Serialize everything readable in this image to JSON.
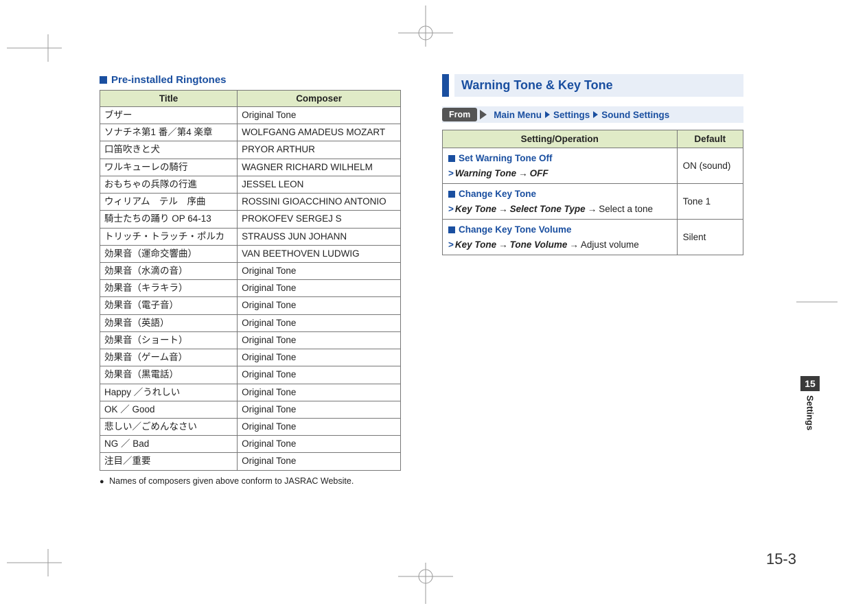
{
  "left": {
    "heading": "Pre-installed Ringtones",
    "table_headers": {
      "title": "Title",
      "composer": "Composer"
    },
    "rows": [
      {
        "title": "ブザー",
        "composer": "Original Tone"
      },
      {
        "title": "ソナチネ第1 番／第4 楽章",
        "composer": "WOLFGANG AMADEUS MOZART"
      },
      {
        "title": "口笛吹きと犬",
        "composer": "PRYOR ARTHUR"
      },
      {
        "title": "ワルキューレの騎行",
        "composer": "WAGNER RICHARD WILHELM"
      },
      {
        "title": "おもちゃの兵隊の行進",
        "composer": "JESSEL LEON"
      },
      {
        "title": "ウィリアム　テル　序曲",
        "composer": "ROSSINI GIOACCHINO ANTONIO"
      },
      {
        "title": "騎士たちの踊り OP 64-13",
        "composer": "PROKOFEV SERGEJ S"
      },
      {
        "title": "トリッチ・トラッチ・ポルカ",
        "composer": "STRAUSS JUN JOHANN"
      },
      {
        "title": "効果音（運命交響曲）",
        "composer": "VAN BEETHOVEN LUDWIG"
      },
      {
        "title": "効果音（水滴の音）",
        "composer": "Original Tone"
      },
      {
        "title": "効果音（キラキラ）",
        "composer": "Original Tone"
      },
      {
        "title": "効果音（電子音）",
        "composer": "Original Tone"
      },
      {
        "title": "効果音（英語）",
        "composer": "Original Tone"
      },
      {
        "title": "効果音（ショート）",
        "composer": "Original Tone"
      },
      {
        "title": "効果音（ゲーム音）",
        "composer": "Original Tone"
      },
      {
        "title": "効果音（黒電話）",
        "composer": "Original Tone"
      },
      {
        "title": "Happy ／うれしい",
        "composer": "Original Tone"
      },
      {
        "title": "OK ／ Good",
        "composer": "Original Tone"
      },
      {
        "title": "悲しい／ごめんなさい",
        "composer": "Original Tone"
      },
      {
        "title": "NG ／ Bad",
        "composer": "Original Tone"
      },
      {
        "title": "注目／重要",
        "composer": "Original Tone"
      }
    ],
    "note": "Names of composers given above conform to JASRAC Website."
  },
  "right": {
    "section_title": "Warning Tone & Key Tone",
    "from_label": "From",
    "breadcrumb": [
      "Main Menu",
      "Settings",
      "Sound Settings"
    ],
    "table_headers": {
      "op": "Setting/Operation",
      "def": "Default"
    },
    "rows": [
      {
        "head": "Set Warning Tone Off",
        "path_bold1": "Warning Tone",
        "arrow1": "→",
        "path_bold2": "OFF",
        "tail": "",
        "default": "ON (sound)"
      },
      {
        "head": "Change Key Tone",
        "path_bold1": "Key Tone",
        "arrow1": "→",
        "path_bold2": "Select Tone Type",
        "arrow2": "→",
        "tail": "Select a tone",
        "default": "Tone 1"
      },
      {
        "head": "Change Key Tone Volume",
        "path_bold1": "Key Tone",
        "arrow1": "→",
        "path_bold2": "Tone Volume",
        "arrow2": "→",
        "tail": "Adjust volume",
        "default": "Silent"
      }
    ]
  },
  "side": {
    "chapter": "15",
    "label": "Settings"
  },
  "page_number": "15-3"
}
